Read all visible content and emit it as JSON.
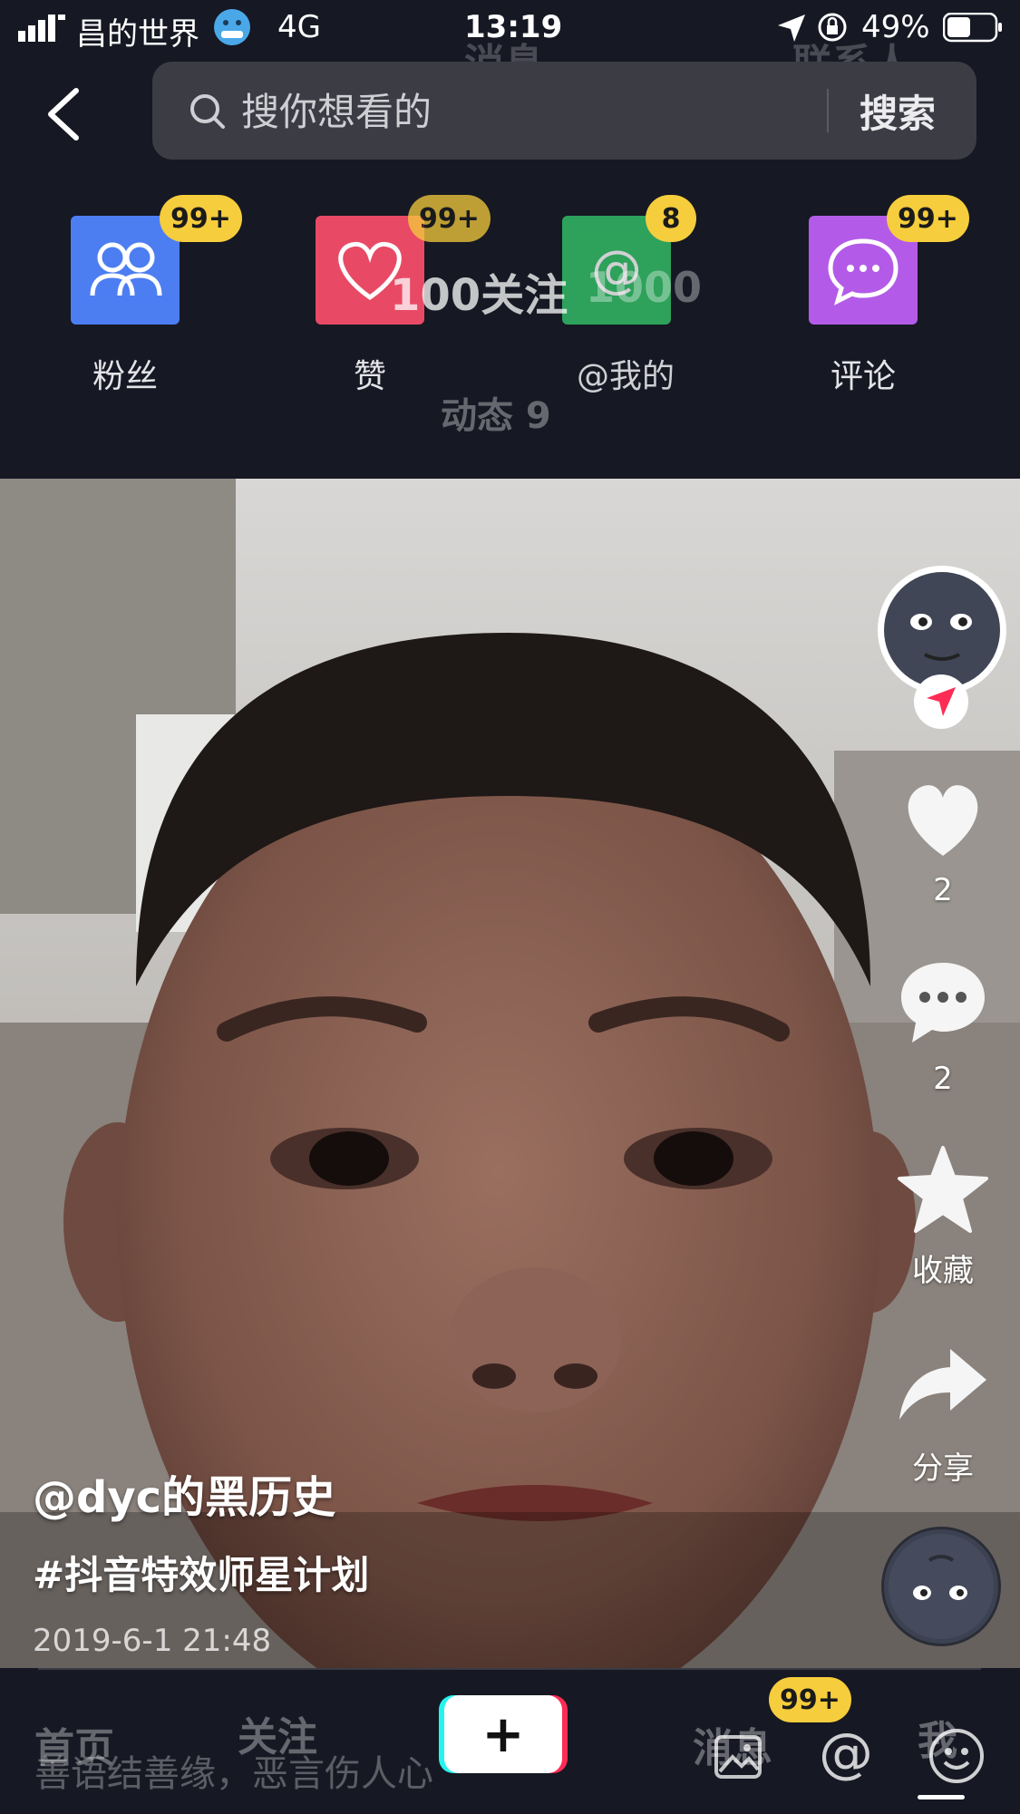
{
  "status_bar": {
    "carrier": "昌的世界",
    "network": "4G",
    "time": "13:19",
    "battery": "49%"
  },
  "ghost_header": {
    "left_tab": "消息",
    "right_tab": "联系人",
    "follow_count": "100关注",
    "overlap_number": "1000",
    "dynamic": "动态 9"
  },
  "search": {
    "placeholder": "搜你想看的",
    "button": "搜索"
  },
  "notifications": [
    {
      "label": "粉丝",
      "badge": "99+",
      "color": "#4c7ef2"
    },
    {
      "label": "赞",
      "badge": "99+",
      "color": "#e84a65"
    },
    {
      "label": "@我的",
      "badge": "8",
      "color": "#35c46a"
    },
    {
      "label": "评论",
      "badge": "99+",
      "color": "#b35be8"
    }
  ],
  "side_actions": {
    "like_count": "2",
    "comment_count": "2",
    "favorite_label": "收藏",
    "share_label": "分享"
  },
  "caption": {
    "user": "@dyc的黑历史",
    "hashtag": "#抖音特效师星计划",
    "datetime": "2019-6-1 21:48"
  },
  "bottom_nav": {
    "home": "首页",
    "follow": "关注",
    "plus": "+",
    "message": "消息",
    "me": "我",
    "message_badge": "99+",
    "comment_placeholder": "善语结善缘，恶言伤人心"
  },
  "colors": {
    "background": "#161823",
    "badge": "#f6cd3c",
    "accent_red": "#fe2c55"
  }
}
